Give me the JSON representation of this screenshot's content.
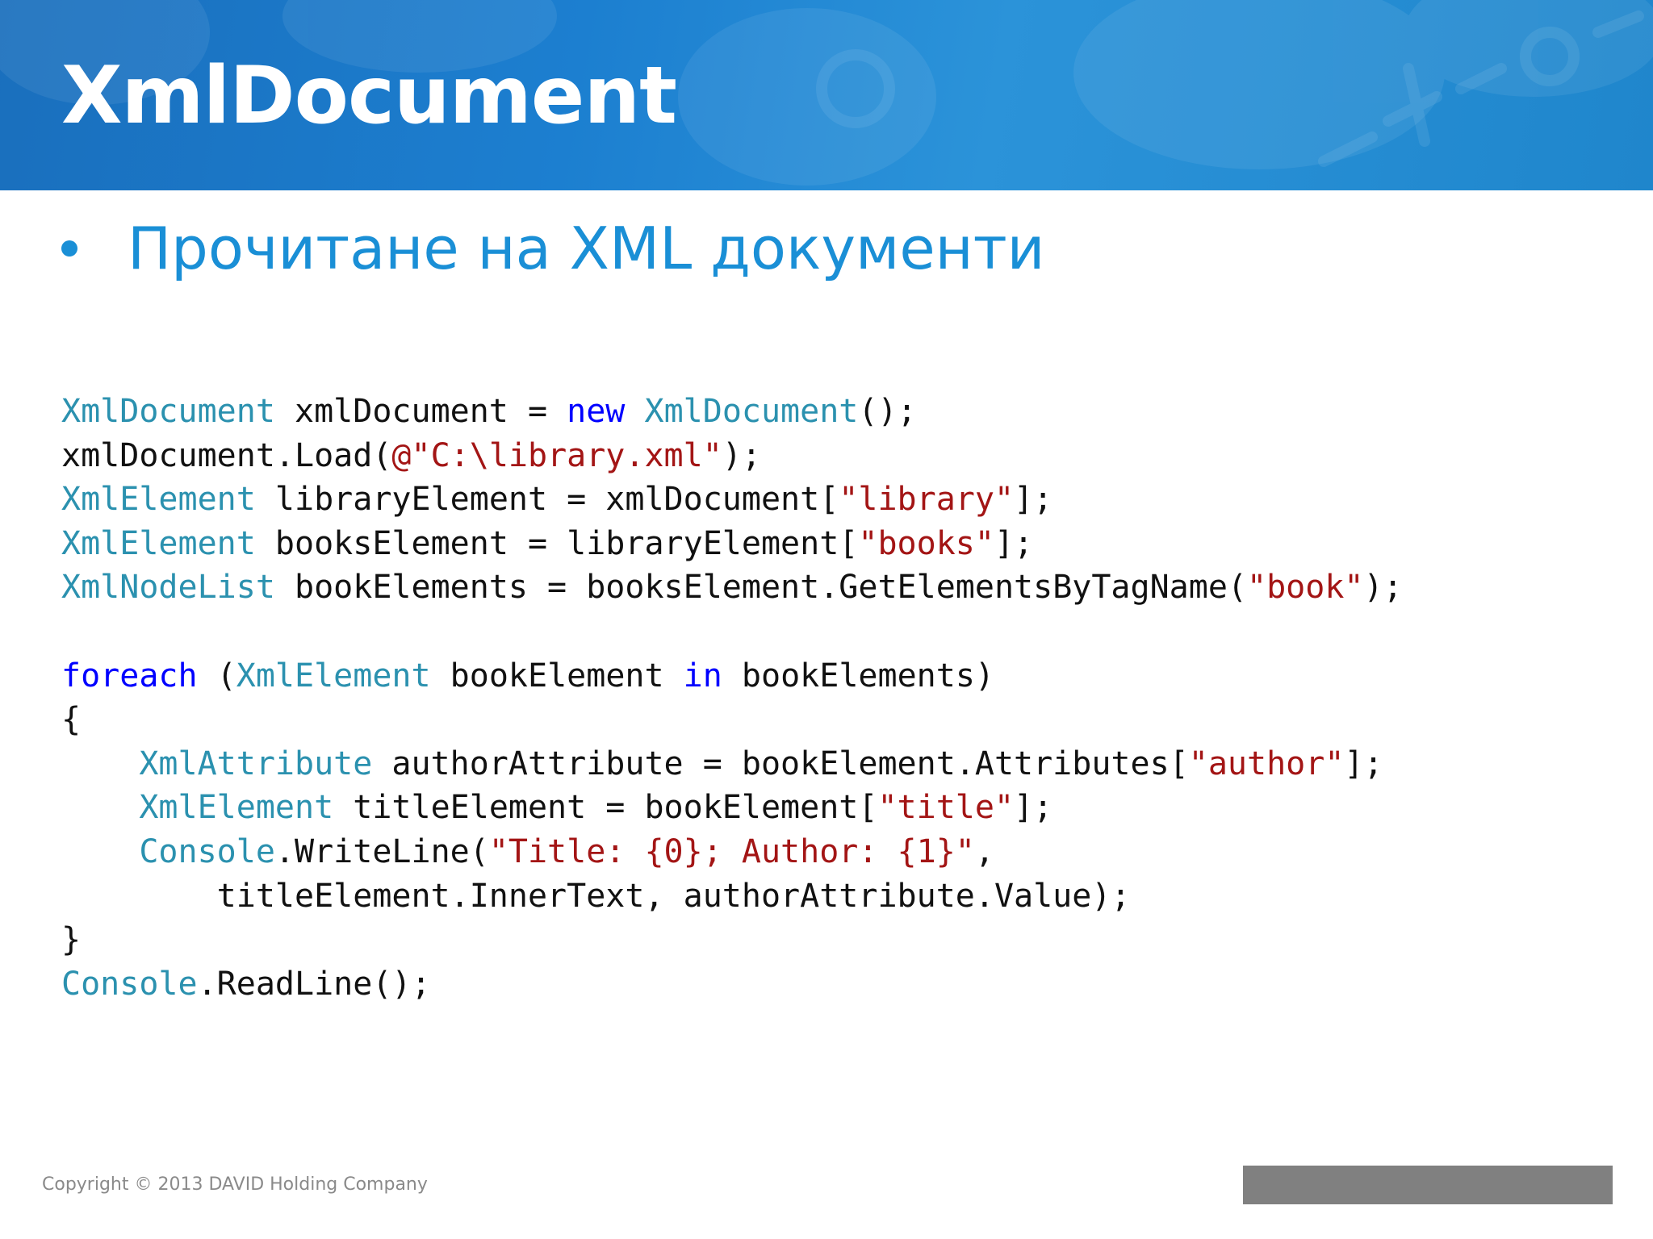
{
  "slide": {
    "title": "XmlDocument",
    "bullet": "Прочитане на XML документи",
    "footer": "Copyright © 2013 DAVID Holding Company"
  },
  "code_lines": [
    [
      {
        "t": "XmlDocument",
        "c": "ty"
      },
      {
        "t": " xmlDocument = "
      },
      {
        "t": "new",
        "c": "kw"
      },
      {
        "t": " "
      },
      {
        "t": "XmlDocument",
        "c": "ty"
      },
      {
        "t": "();"
      }
    ],
    [
      {
        "t": "xmlDocument.Load("
      },
      {
        "t": "@\"C:\\library.xml\"",
        "c": "st"
      },
      {
        "t": ");"
      }
    ],
    [
      {
        "t": "XmlElement",
        "c": "ty"
      },
      {
        "t": " libraryElement = xmlDocument["
      },
      {
        "t": "\"library\"",
        "c": "st"
      },
      {
        "t": "];"
      }
    ],
    [
      {
        "t": "XmlElement",
        "c": "ty"
      },
      {
        "t": " booksElement = libraryElement["
      },
      {
        "t": "\"books\"",
        "c": "st"
      },
      {
        "t": "];"
      }
    ],
    [
      {
        "t": "XmlNodeList",
        "c": "ty"
      },
      {
        "t": " bookElements = booksElement.GetElementsByTagName("
      },
      {
        "t": "\"book\"",
        "c": "st"
      },
      {
        "t": ");"
      }
    ],
    [],
    [
      {
        "t": "foreach",
        "c": "kw"
      },
      {
        "t": " ("
      },
      {
        "t": "XmlElement",
        "c": "ty"
      },
      {
        "t": " bookElement "
      },
      {
        "t": "in",
        "c": "kw"
      },
      {
        "t": " bookElements)"
      }
    ],
    [
      {
        "t": "{"
      }
    ],
    [
      {
        "t": "    "
      },
      {
        "t": "XmlAttribute",
        "c": "ty"
      },
      {
        "t": " authorAttribute = bookElement.Attributes["
      },
      {
        "t": "\"author\"",
        "c": "st"
      },
      {
        "t": "];"
      }
    ],
    [
      {
        "t": "    "
      },
      {
        "t": "XmlElement",
        "c": "ty"
      },
      {
        "t": " titleElement = bookElement["
      },
      {
        "t": "\"title\"",
        "c": "st"
      },
      {
        "t": "];"
      }
    ],
    [
      {
        "t": "    "
      },
      {
        "t": "Console",
        "c": "ty"
      },
      {
        "t": ".WriteLine("
      },
      {
        "t": "\"Title: {0}; Author: {1}\"",
        "c": "st"
      },
      {
        "t": ","
      }
    ],
    [
      {
        "t": "        titleElement.InnerText, authorAttribute.Value);"
      }
    ],
    [
      {
        "t": "}"
      }
    ],
    [
      {
        "t": "Console",
        "c": "ty"
      },
      {
        "t": ".ReadLine();"
      }
    ]
  ]
}
